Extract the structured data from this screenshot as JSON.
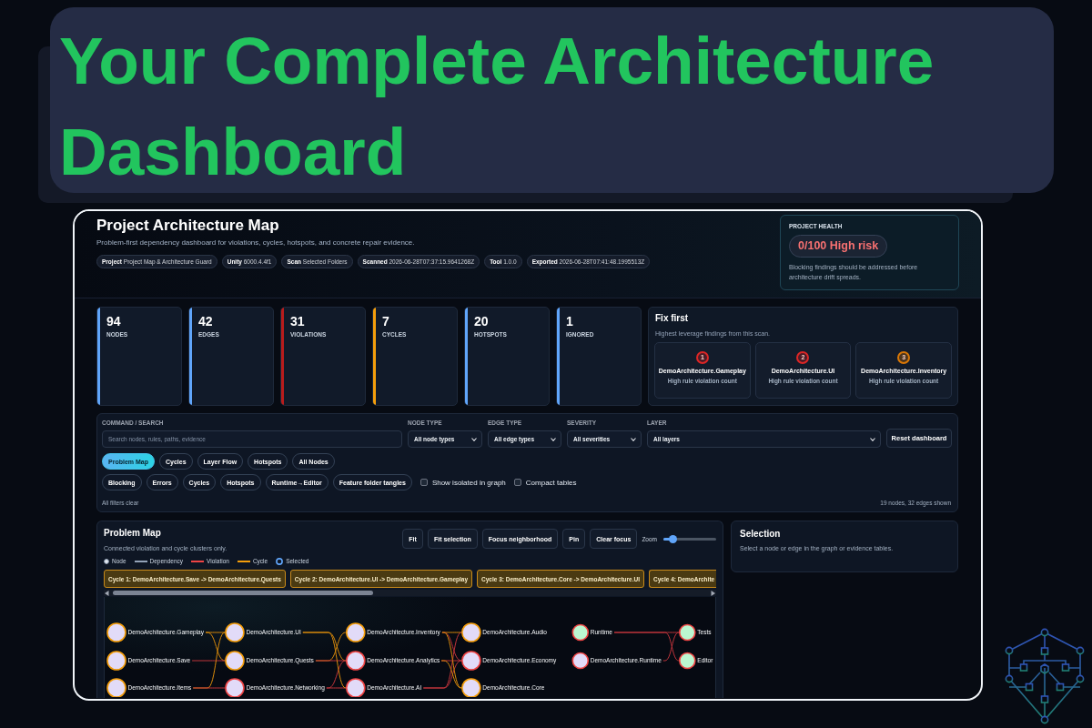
{
  "banner": {
    "title": "Your Complete Architecture Dashboard"
  },
  "dashboard": {
    "header": {
      "title": "Project Architecture Map",
      "subtitle": "Problem-first dependency dashboard for violations, cycles, hotspots, and concrete repair evidence.",
      "meta": [
        {
          "label": "Project",
          "value": "Project Map & Architecture Guard"
        },
        {
          "label": "Unity",
          "value": "6000.4.4f1"
        },
        {
          "label": "Scan",
          "value": "Selected Folders"
        },
        {
          "label": "Scanned",
          "value": "2026-06-28T07:37:15.9641268Z"
        },
        {
          "label": "Tool",
          "value": "1.0.0"
        },
        {
          "label": "Exported",
          "value": "2026-06-28T07:41:48.1995513Z"
        }
      ]
    },
    "health": {
      "label": "PROJECT HEALTH",
      "score": "0/100 High risk",
      "note": "Blocking findings should be addressed before architecture drift spreads."
    },
    "stats": [
      {
        "value": "94",
        "label": "NODES",
        "color": "#60a5fa"
      },
      {
        "value": "42",
        "label": "EDGES",
        "color": "#60a5fa"
      },
      {
        "value": "31",
        "label": "VIOLATIONS",
        "color": "#b91c1c"
      },
      {
        "value": "7",
        "label": "CYCLES",
        "color": "#f59e0b"
      },
      {
        "value": "20",
        "label": "HOTSPOTS",
        "color": "#60a5fa"
      },
      {
        "value": "1",
        "label": "IGNORED",
        "color": "#60a5fa"
      }
    ],
    "fix_first": {
      "title": "Fix first",
      "subtitle": "Highest leverage findings from this scan.",
      "items": [
        {
          "rank": "1",
          "name": "DemoArchitecture.Gameplay",
          "reason": "High rule violation count",
          "color": "#dc2626"
        },
        {
          "rank": "2",
          "name": "DemoArchitecture.UI",
          "reason": "High rule violation count",
          "color": "#dc2626"
        },
        {
          "rank": "3",
          "name": "DemoArchitecture.Inventory",
          "reason": "High rule violation count",
          "color": "#d97706"
        }
      ]
    },
    "filters": {
      "search": {
        "label": "COMMAND / SEARCH",
        "placeholder": "Search nodes, rules, paths, evidence"
      },
      "selects": [
        {
          "label": "NODE TYPE",
          "value": "All node types"
        },
        {
          "label": "EDGE TYPE",
          "value": "All edge types"
        },
        {
          "label": "SEVERITY",
          "value": "All severities"
        },
        {
          "label": "LAYER",
          "value": "All layers"
        }
      ],
      "reset_button": "Reset dashboard",
      "views": [
        {
          "label": "Problem Map",
          "selected": true
        },
        {
          "label": "Cycles",
          "selected": false
        },
        {
          "label": "Layer Flow",
          "selected": false
        },
        {
          "label": "Hotspots",
          "selected": false
        },
        {
          "label": "All Nodes",
          "selected": false
        }
      ],
      "quick_filters": [
        {
          "label": "Blocking",
          "selected": false
        },
        {
          "label": "Errors",
          "selected": false
        },
        {
          "label": "Cycles",
          "selected": false
        },
        {
          "label": "Hotspots",
          "selected": false
        },
        {
          "label": "Runtime→Editor",
          "selected": false
        },
        {
          "label": "Feature folder tangles",
          "selected": false
        }
      ],
      "toggles": [
        {
          "label": "Show isolated in graph",
          "checked": false
        },
        {
          "label": "Compact tables",
          "checked": false
        }
      ],
      "status": "All filters clear",
      "count": "19 nodes, 32 edges shown"
    },
    "problem_map": {
      "title": "Problem Map",
      "subtitle": "Connected violation and cycle clusters only.",
      "buttons": [
        "Fit",
        "Fit selection",
        "Focus neighborhood",
        "Pin",
        "Clear focus"
      ],
      "zoom": {
        "label": "Zoom",
        "level": 0.18
      },
      "legend": [
        {
          "label": "Node",
          "kind": "node"
        },
        {
          "label": "Dependency",
          "kind": "line",
          "color": "#94a3b8"
        },
        {
          "label": "Violation",
          "kind": "line",
          "color": "#ef4444"
        },
        {
          "label": "Cycle",
          "kind": "line",
          "color": "#f59e0b"
        },
        {
          "label": "Selected",
          "kind": "ring",
          "color": "#60a5fa"
        }
      ],
      "cycles": [
        "Cycle 1: DemoArchitecture.Save -> DemoArchitecture.Quests",
        "Cycle 2: DemoArchitecture.UI -> DemoArchitecture.Gameplay",
        "Cycle 3: DemoArchitecture.Core -> DemoArchitecture.UI",
        "Cycle 4: DemoArchite"
      ],
      "graph": {
        "clusters": [
          {
            "columns": [
              {
                "nodes": [
                  {
                    "label": "DemoArchitecture.Gameplay",
                    "kind": "cycle",
                    "color": "#e2dbf8"
                  },
                  {
                    "label": "DemoArchitecture.Save",
                    "kind": "cycle",
                    "color": "#e2dbf8"
                  },
                  {
                    "label": "DemoArchitecture.Items",
                    "kind": "cycle",
                    "color": "#e2dbf8"
                  }
                ]
              },
              {
                "nodes": [
                  {
                    "label": "DemoArchitecture.UI",
                    "kind": "cycle",
                    "color": "#e2dbf8"
                  },
                  {
                    "label": "DemoArchitecture.Quests",
                    "kind": "cycle",
                    "color": "#e2dbf8"
                  },
                  {
                    "label": "DemoArchitecture.Networking",
                    "kind": "violation",
                    "color": "#e2dbf8"
                  }
                ]
              },
              {
                "nodes": [
                  {
                    "label": "DemoArchitecture.Inventory",
                    "kind": "cycle",
                    "color": "#e2dbf8"
                  },
                  {
                    "label": "DemoArchitecture.Analytics",
                    "kind": "violation",
                    "color": "#e2dbf8"
                  },
                  {
                    "label": "DemoArchitecture.AI",
                    "kind": "violation",
                    "color": "#e2dbf8"
                  }
                ]
              },
              {
                "nodes": [
                  {
                    "label": "DemoArchitecture.Audio",
                    "kind": "cycle",
                    "color": "#e2dbf8"
                  },
                  {
                    "label": "DemoArchitecture.Economy",
                    "kind": "violation",
                    "color": "#e2dbf8"
                  },
                  {
                    "label": "DemoArchitecture.Core",
                    "kind": "cycle",
                    "color": "#e2dbf8"
                  }
                ]
              }
            ]
          },
          {
            "columns": [
              {
                "nodes": [
                  {
                    "label": "Runtime",
                    "kind": "violation",
                    "color": "#bbf7d0"
                  },
                  {
                    "label": "DemoArchitecture.Runtime",
                    "kind": "violation",
                    "color": "#e2dbf8"
                  }
                ]
              },
              {
                "nodes": [
                  {
                    "label": "Tests",
                    "kind": "violation",
                    "color": "#bbf7d0"
                  },
                  {
                    "label": "Editor",
                    "kind": "violation",
                    "color": "#bbf7d0"
                  }
                ]
              }
            ]
          }
        ]
      }
    },
    "selection": {
      "title": "Selection",
      "hint": "Select a node or edge in the graph or evidence tables."
    }
  }
}
